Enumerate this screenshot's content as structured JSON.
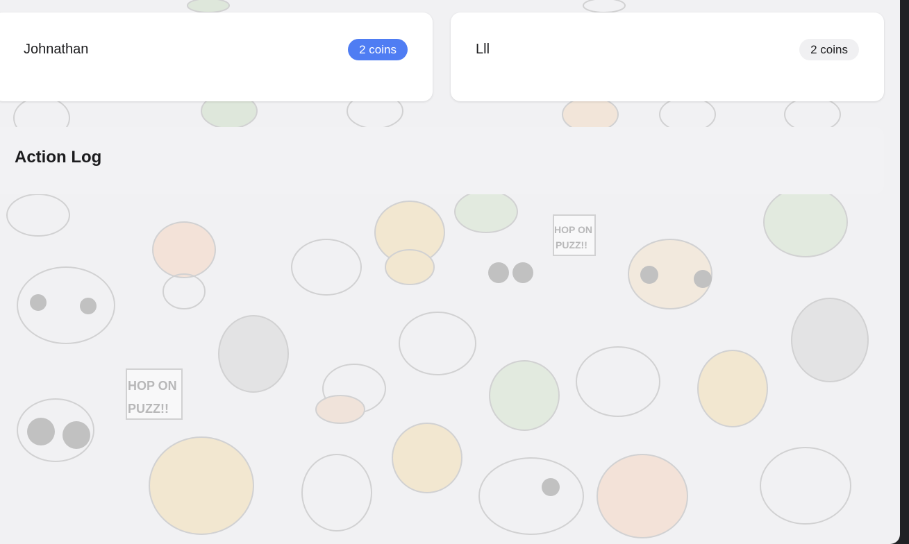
{
  "players": [
    {
      "name": "Johnathan",
      "coins": "2 coins",
      "active": true
    },
    {
      "name": "Lll",
      "coins": "2 coins",
      "active": false
    }
  ],
  "action_log": {
    "title": "Action Log"
  },
  "background": {
    "sticker_text_line1": "HOP ON",
    "sticker_text_line2": "PUZZ!!"
  },
  "colors": {
    "active_badge": "#4f7df3",
    "inactive_badge": "#f0f0f2",
    "page_bg": "#f1f1f3"
  }
}
